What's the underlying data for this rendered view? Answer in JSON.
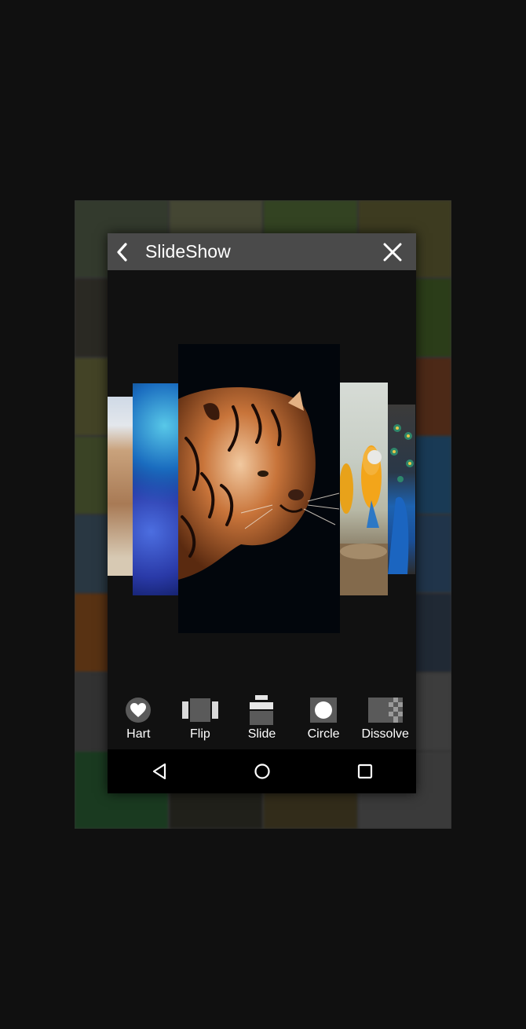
{
  "app": {
    "title": "SlideShow"
  },
  "effects": [
    {
      "label": "Hart",
      "icon": "heart-icon"
    },
    {
      "label": "Flip",
      "icon": "flip-icon"
    },
    {
      "label": "Slide",
      "icon": "slide-icon"
    },
    {
      "label": "Circle",
      "icon": "circle-icon"
    },
    {
      "label": "Dissolve",
      "icon": "dissolve-icon"
    }
  ],
  "nav": [
    "back-triangle-icon",
    "home-circle-icon",
    "recents-square-icon"
  ],
  "colors": {
    "page_bg": "#101010",
    "appbar_bg": "#4a4a4a",
    "screen_bg": "#111111",
    "navbar_bg": "#000000",
    "icon_gray": "#5a5a5a",
    "text": "#ffffff"
  }
}
